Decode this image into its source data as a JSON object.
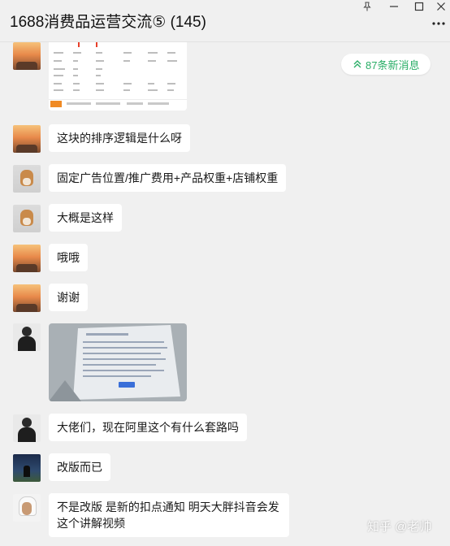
{
  "window": {
    "title": "1688消费品运营交流⑤ (145)",
    "buttons": [
      "pin-icon",
      "minimize-icon",
      "maximize-icon",
      "close-icon"
    ],
    "more_icon": "more-dots-icon"
  },
  "new_messages": {
    "label": "87条新消息",
    "icon": "double-chevron-up-icon"
  },
  "messages": [
    {
      "type": "image",
      "avatar": "sunset"
    },
    {
      "type": "text",
      "avatar": "sunset",
      "text": "这块的排序逻辑是什么呀"
    },
    {
      "type": "text",
      "avatar": "dog",
      "text": "固定广告位置/推广费用+产品权重+店铺权重"
    },
    {
      "type": "text",
      "avatar": "dog",
      "text": "大概是这样"
    },
    {
      "type": "text",
      "avatar": "sunset",
      "text": "哦哦"
    },
    {
      "type": "text",
      "avatar": "sunset",
      "text": "谢谢"
    },
    {
      "type": "image",
      "avatar": "man"
    },
    {
      "type": "text",
      "avatar": "man",
      "text": "大佬们，现在阿里这个有什么套路吗"
    },
    {
      "type": "text",
      "avatar": "night",
      "text": "改版而已"
    },
    {
      "type": "text",
      "avatar": "arab",
      "text": "不是改版  是新的扣点通知  明天大胖抖音会发这个讲解视频"
    }
  ],
  "watermark": "知乎 @老帅",
  "colors": {
    "accent": "#2aae67",
    "background": "#f0f0f0",
    "bubble": "#ffffff",
    "orange": "#f08a24"
  }
}
